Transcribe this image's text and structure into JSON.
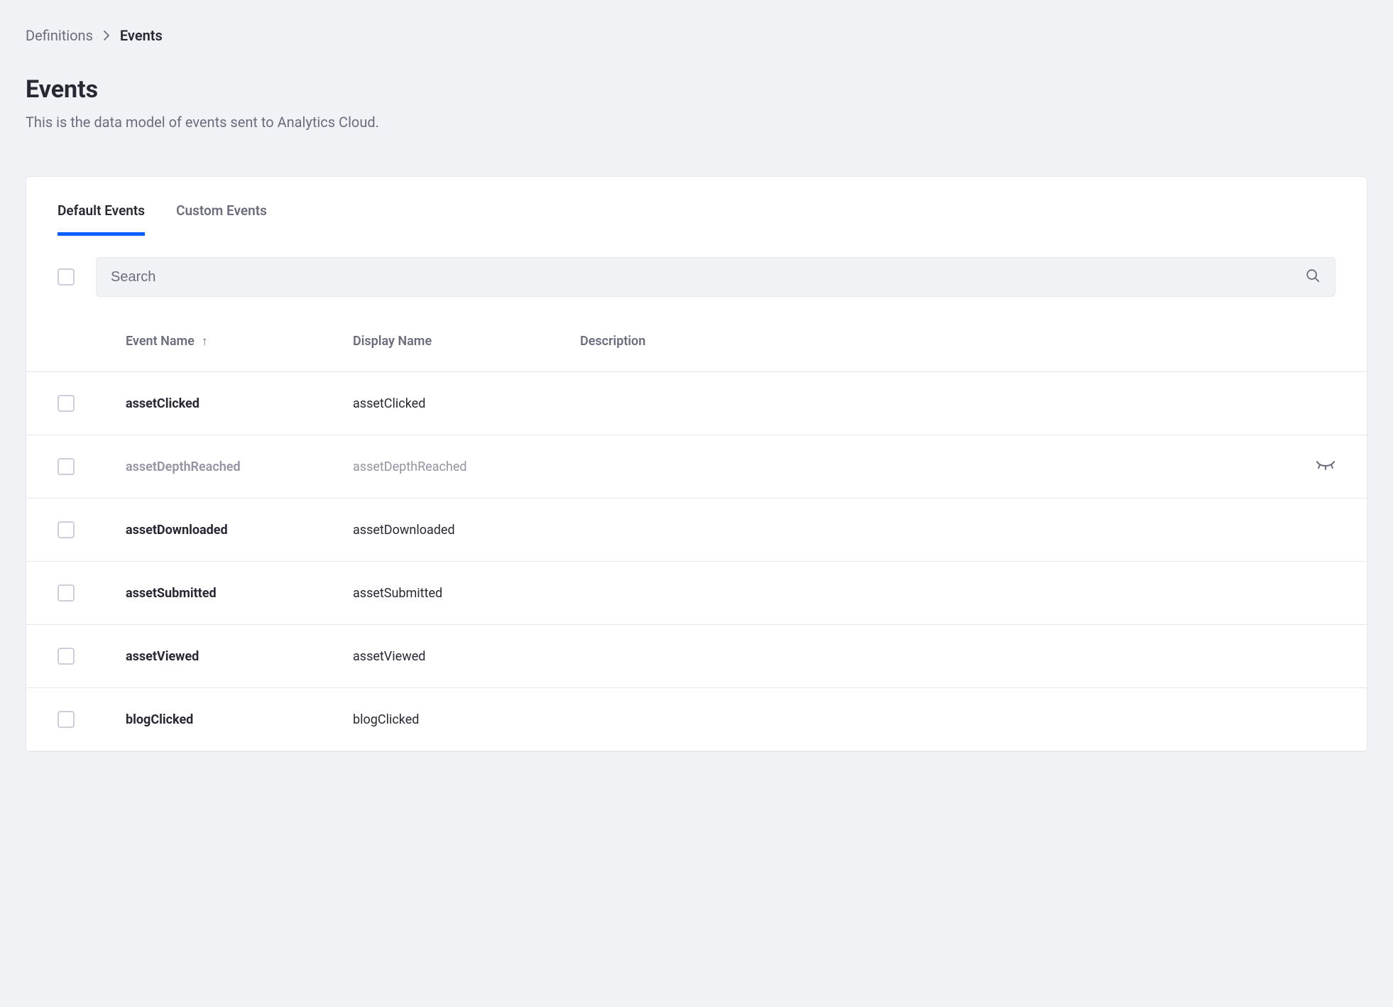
{
  "breadcrumb": {
    "parent": "Definitions",
    "current": "Events"
  },
  "header": {
    "title": "Events",
    "subtitle": "This is the data model of events sent to Analytics Cloud."
  },
  "tabs": {
    "default": "Default Events",
    "custom": "Custom Events"
  },
  "search": {
    "placeholder": "Search"
  },
  "table": {
    "columns": {
      "event_name": "Event Name",
      "display_name": "Display Name",
      "description": "Description"
    },
    "rows": [
      {
        "event_name": "assetClicked",
        "display_name": "assetClicked",
        "description": "",
        "hidden": false
      },
      {
        "event_name": "assetDepthReached",
        "display_name": "assetDepthReached",
        "description": "",
        "hidden": true
      },
      {
        "event_name": "assetDownloaded",
        "display_name": "assetDownloaded",
        "description": "",
        "hidden": false
      },
      {
        "event_name": "assetSubmitted",
        "display_name": "assetSubmitted",
        "description": "",
        "hidden": false
      },
      {
        "event_name": "assetViewed",
        "display_name": "assetViewed",
        "description": "",
        "hidden": false
      },
      {
        "event_name": "blogClicked",
        "display_name": "blogClicked",
        "description": "",
        "hidden": false
      }
    ]
  }
}
